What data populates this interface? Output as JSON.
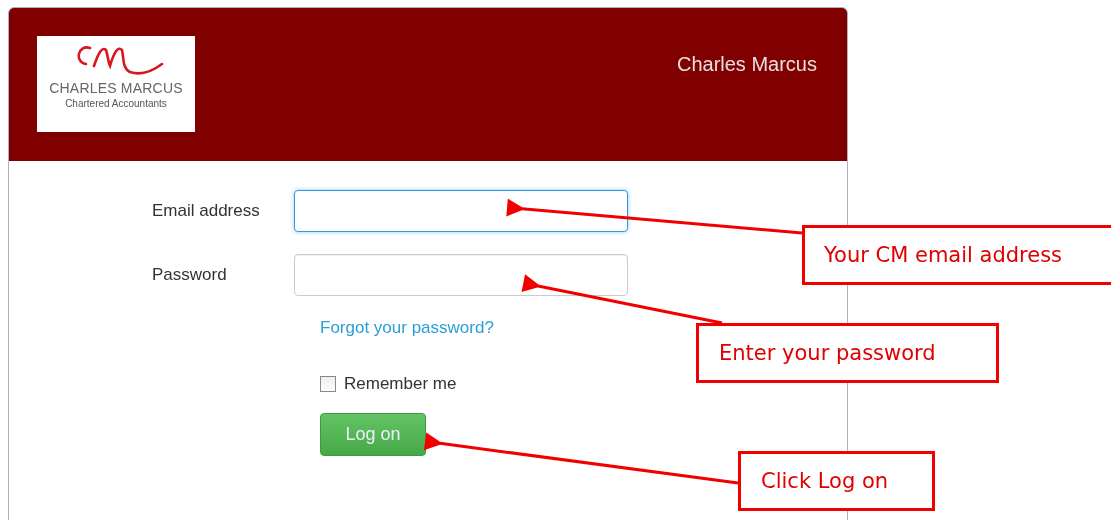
{
  "header": {
    "logo": {
      "name": "CHARLES MARCUS",
      "tagline": "Chartered Accountants"
    },
    "title": "Charles Marcus"
  },
  "form": {
    "fields": [
      {
        "label": "Email address",
        "focused": true
      },
      {
        "label": "Password",
        "focused": false
      }
    ],
    "forgot_link": "Forgot your password?",
    "remember": {
      "label": "Remember me",
      "checked": false
    },
    "submit": "Log on"
  },
  "callouts": [
    {
      "text": "Your CM email address"
    },
    {
      "text": "Enter your password"
    },
    {
      "text": "Click Log on"
    }
  ]
}
